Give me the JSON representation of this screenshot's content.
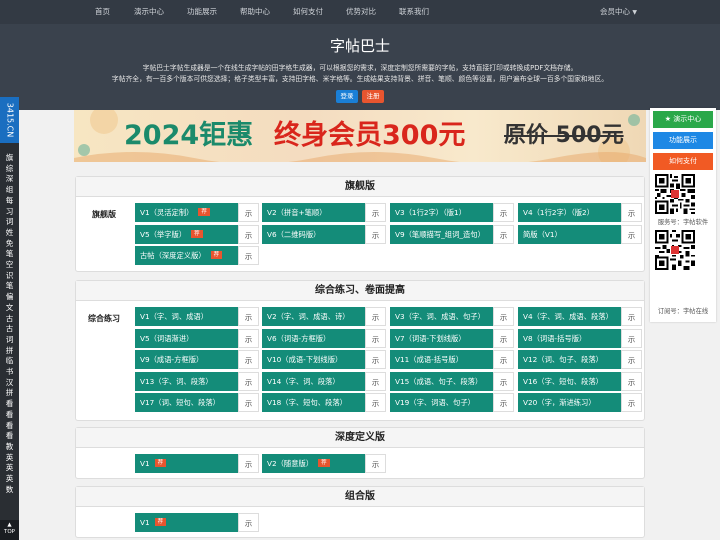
{
  "nav": {
    "items": [
      "首页",
      "演示中心",
      "功能展示",
      "帮助中心",
      "如何支付",
      "优势对比",
      "联系我们"
    ],
    "member": "会员中心"
  },
  "hero": {
    "title": "字帖巴士",
    "line1": "字帖巴士字帖生成器是一个在线生成字帖的田字格生成器，可以根据您的需求，深度定制您所需要的字帖，支持直接打印或转换成PDF文档存储。",
    "line2": "字帖齐全，有一百多个版本可供您选择；格子类型丰富，支持田字格、米字格等。生成结果支持背景、拼音、笔顺、颜色等设置，用户遍布全球一百多个国家和地区。",
    "login": "登录",
    "register": "注册"
  },
  "banner": {
    "part1": "2024钜惠",
    "part2": "终身会员300元",
    "part3": "原价 500元"
  },
  "sidebar": {
    "domain": "3415.CN",
    "text": "旗综深组每习词姓免笔空识笔偏文古古词拼临书汉拼看看看看教英英英数",
    "top": "TOP"
  },
  "right_panel": {
    "demo": "★ 演示中心",
    "features": "功能展示",
    "pay": "如何支付",
    "service": "服务号：字帖软件",
    "subscribe": "订阅号：字帖在线"
  },
  "sections": [
    {
      "title": "旗舰版",
      "sub": "旗舰版",
      "items": [
        {
          "label": "V1（灵活定制）",
          "tag": "荐",
          "side": "示"
        },
        {
          "label": "V2（拼音+笔顺）",
          "side": "示"
        },
        {
          "label": "V3（1行2字）（版1）",
          "side": "示"
        },
        {
          "label": "V4（1行2字）（版2）",
          "side": "示"
        },
        {
          "label": "V5（举字版）",
          "tag": "荐",
          "side": "示"
        },
        {
          "label": "V6（二维码版）",
          "side": "示"
        },
        {
          "label": "V9（笔顺描写_组词_造句）",
          "side": "示"
        },
        {
          "label": "简版（V1）",
          "side": "示"
        },
        {
          "label": "古帖（深度定义版）",
          "tag": "荐",
          "side": "示"
        }
      ]
    },
    {
      "title": "综合练习、卷面提高",
      "sub": "综合练习",
      "items": [
        {
          "label": "V1（字、词、成语）",
          "side": "示"
        },
        {
          "label": "V2（字、词、成语、诗）",
          "side": "示"
        },
        {
          "label": "V3（字、词、成语、句子）",
          "side": "示"
        },
        {
          "label": "V4（字、词、成语、段落）",
          "side": "示"
        },
        {
          "label": "V5（词语渐进）",
          "side": "示"
        },
        {
          "label": "V6（词语-方框版）",
          "side": "示"
        },
        {
          "label": "V7（词语-下划线版）",
          "side": "示"
        },
        {
          "label": "V8（词语-括号版）",
          "side": "示"
        },
        {
          "label": "V9（成语-方框版）",
          "side": "示"
        },
        {
          "label": "V10（成语-下划线版）",
          "side": "示"
        },
        {
          "label": "V11（成语-括号版）",
          "side": "示"
        },
        {
          "label": "V12（词、句子、段落）",
          "side": "示"
        },
        {
          "label": "V13（字、词、段落）",
          "side": "示"
        },
        {
          "label": "V14（字、词、段落）",
          "side": "示"
        },
        {
          "label": "V15（成语、句子、段落）",
          "side": "示"
        },
        {
          "label": "V16（字、短句、段落）",
          "side": "示"
        },
        {
          "label": "V17（词、短句、段落）",
          "side": "示"
        },
        {
          "label": "V18（字、短句、段落）",
          "side": "示"
        },
        {
          "label": "V19（字、词语、句子）",
          "side": "示"
        },
        {
          "label": "V20（字，渐进练习）",
          "side": "示"
        }
      ]
    },
    {
      "title": "深度定义版",
      "sub": "",
      "items": [
        {
          "label": "V1",
          "tag": "荐",
          "side": "示"
        },
        {
          "label": "V2（随意版）",
          "tag": "荐",
          "side": "示"
        }
      ]
    },
    {
      "title": "组合版",
      "sub": "",
      "items": [
        {
          "label": "V1",
          "tag": "荐",
          "side": "示"
        }
      ]
    }
  ],
  "colors": {
    "nav": "#333a44",
    "hero": "#3a424d",
    "teal": "#148c79",
    "tag": "#e8552f",
    "login": "#1a7fd6",
    "register": "#e8552f",
    "green": "#2aa84a",
    "blue": "#1e88e5",
    "orange": "#f15a24"
  }
}
